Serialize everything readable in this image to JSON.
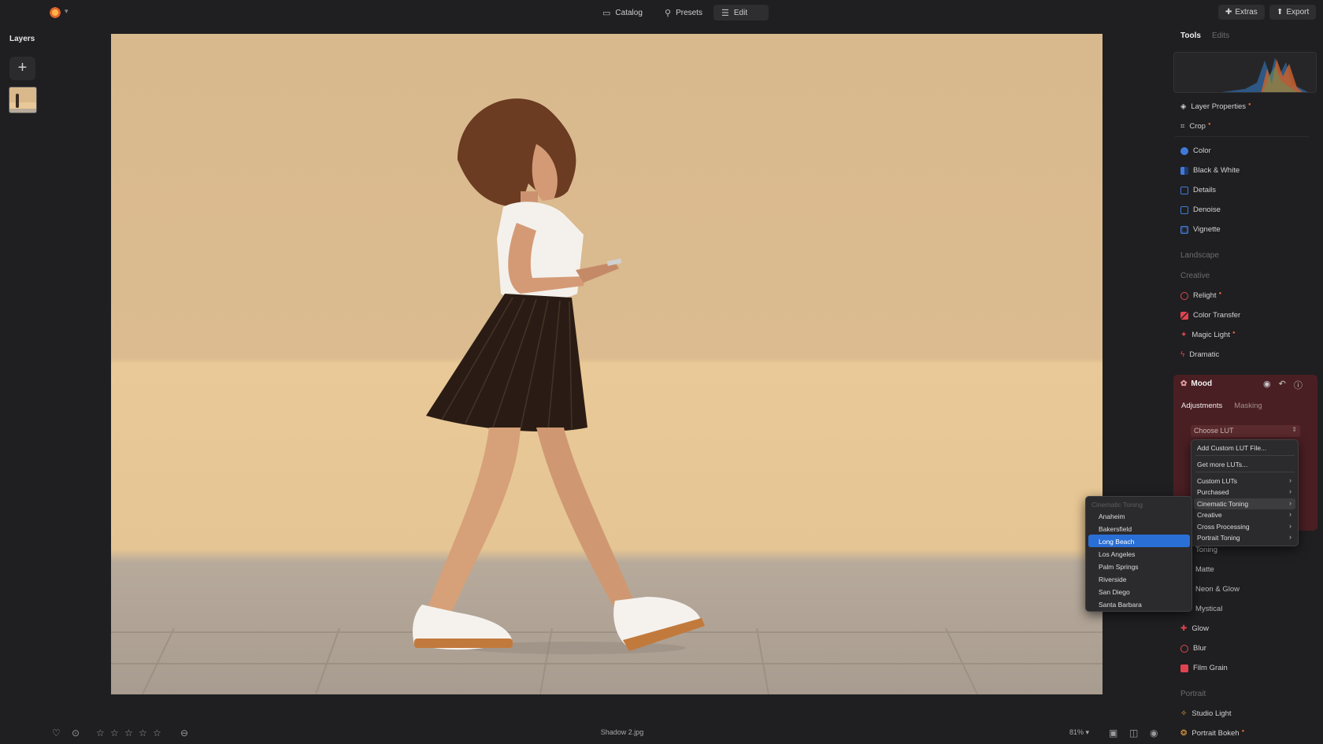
{
  "topbar": {
    "catalog_label": "Catalog",
    "presets_label": "Presets",
    "edit_label": "Edit",
    "extras_label": "Extras",
    "export_label": "Export"
  },
  "layers": {
    "title": "Layers",
    "add_label": "+"
  },
  "tools_panel": {
    "tab_tools": "Tools",
    "tab_edits": "Edits",
    "items_top": [
      {
        "label": "Layer Properties",
        "icon": "layers-icon"
      },
      {
        "label": "Crop",
        "icon": "crop-icon"
      }
    ],
    "items_essentials": [
      {
        "label": "Color",
        "icon": "color-icon"
      },
      {
        "label": "Black & White",
        "icon": "bw-icon"
      },
      {
        "label": "Details",
        "icon": "details-icon"
      },
      {
        "label": "Denoise",
        "icon": "denoise-icon"
      },
      {
        "label": "Vignette",
        "icon": "vignette-icon"
      }
    ],
    "section_landscape": "Landscape",
    "section_creative": "Creative",
    "items_creative": [
      {
        "label": "Relight",
        "icon": "relight-icon"
      },
      {
        "label": "Color Transfer",
        "icon": "color-transfer-icon"
      },
      {
        "label": "Magic Light",
        "icon": "magic-light-icon"
      },
      {
        "label": "Dramatic",
        "icon": "dramatic-icon"
      }
    ],
    "mood": {
      "title": "Mood",
      "tab_adjustments": "Adjustments",
      "tab_masking": "Masking",
      "choose_lut": "Choose LUT"
    },
    "partial_items": [
      "Toning",
      "Matte",
      "Neon & Glow",
      "Mystical"
    ],
    "items_creative_bottom": [
      {
        "label": "Glow",
        "icon": "glow-icon"
      },
      {
        "label": "Blur",
        "icon": "blur-icon"
      },
      {
        "label": "Film Grain",
        "icon": "film-grain-icon"
      }
    ],
    "section_portrait": "Portrait",
    "items_portrait": [
      {
        "label": "Studio Light",
        "icon": "studio-light-icon"
      },
      {
        "label": "Portrait Bokeh",
        "icon": "bokeh-icon"
      }
    ]
  },
  "lut_menu": {
    "add_custom": "Add Custom LUT File...",
    "get_more": "Get more LUTs...",
    "categories": [
      "Custom LUTs",
      "Purchased",
      "Cinematic Toning",
      "Creative",
      "Cross Processing",
      "Portrait Toning"
    ]
  },
  "sub_menu": {
    "title": "Cinematic Toning",
    "items": [
      "Anaheim",
      "Bakersfield",
      "Long Beach",
      "Los Angeles",
      "Palm Springs",
      "Riverside",
      "San Diego",
      "Santa Barbara"
    ],
    "selected": "Long Beach"
  },
  "bottombar": {
    "filename": "Shadow 2.jpg",
    "zoom": "81%"
  },
  "colors": {
    "background": "#1f1f21",
    "mood_panel": "#4a1f23",
    "selection": "#2a6fd6",
    "accent_badge": "#e36b3a"
  }
}
